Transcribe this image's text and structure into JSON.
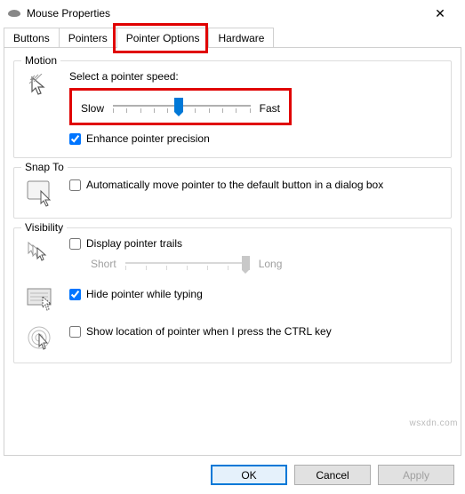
{
  "window": {
    "title": "Mouse Properties",
    "close": "✕"
  },
  "tabs": {
    "items": [
      "Buttons",
      "Pointers",
      "Pointer Options",
      "Hardware"
    ],
    "active": 2
  },
  "motion": {
    "title": "Motion",
    "speed_label": "Select a pointer speed:",
    "slow": "Slow",
    "fast": "Fast",
    "enhance": "Enhance pointer precision",
    "enhance_checked": true,
    "speed_value": 6,
    "speed_max": 11
  },
  "snap": {
    "title": "Snap To",
    "auto": "Automatically move pointer to the default button in a dialog box",
    "auto_checked": false
  },
  "visibility": {
    "title": "Visibility",
    "trails": "Display pointer trails",
    "trails_checked": false,
    "short": "Short",
    "long": "Long",
    "hide": "Hide pointer while typing",
    "hide_checked": true,
    "ctrl": "Show location of pointer when I press the CTRL key",
    "ctrl_checked": false
  },
  "buttons": {
    "ok": "OK",
    "cancel": "Cancel",
    "apply": "Apply"
  },
  "watermark": "wsxdn.com"
}
